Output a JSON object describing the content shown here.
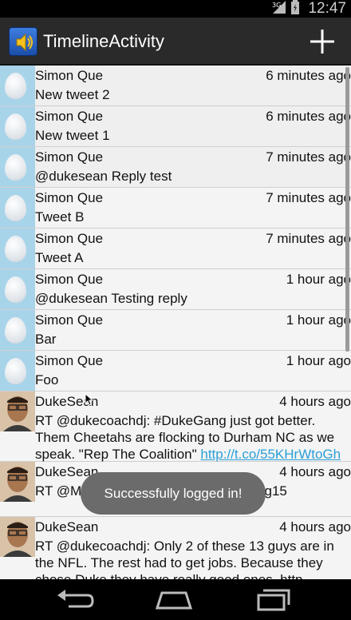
{
  "status_bar": {
    "time": "12:47",
    "network_label": "3G"
  },
  "action_bar": {
    "title": "TimelineActivity",
    "app_icon": "speaker-icon",
    "add_icon": "plus-icon"
  },
  "tweets": [
    {
      "name": "Simon Que",
      "time": "6 minutes ago",
      "text": "New tweet 2",
      "avatar": "egg"
    },
    {
      "name": "Simon Que",
      "time": "6 minutes ago",
      "text": "New tweet 1",
      "avatar": "egg"
    },
    {
      "name": "Simon Que",
      "time": "7 minutes ago",
      "text": "@dukesean Reply test",
      "avatar": "egg"
    },
    {
      "name": "Simon Que",
      "time": "7 minutes ago",
      "text": "Tweet B",
      "avatar": "egg"
    },
    {
      "name": "Simon Que",
      "time": "7 minutes ago",
      "text": "Tweet A",
      "avatar": "egg"
    },
    {
      "name": "Simon Que",
      "time": "1 hour ago",
      "text": "@dukesean Testing reply",
      "avatar": "egg"
    },
    {
      "name": "Simon Que",
      "time": "1 hour ago",
      "text": "Bar",
      "avatar": "egg"
    },
    {
      "name": "Simon Que",
      "time": "1 hour ago",
      "text": "Foo",
      "avatar": "egg"
    },
    {
      "name": "DukeSean",
      "time": "4 hours ago",
      "text": "RT @dukecoachdj: #DukeGang just got better. Them Cheetahs are flocking to Durham NC as we speak. \"Rep The Coalition\" ",
      "link": "http://t.co/55KHrWtoGh",
      "avatar": "photo"
    },
    {
      "name": "DukeSean",
      "time": "4 hours ago",
      "text": "RT @Mattlv... #Coalition15 #DukeGang15",
      "avatar": "photo"
    },
    {
      "name": "DukeSean",
      "time": "4 hours ago",
      "text": "RT @dukecoachdj: Only 2 of these 13 guys are in the NFL. The rest had to get jobs. Because they chose Duke they have really good ones. http",
      "avatar": "photo"
    }
  ],
  "toast": {
    "message": "Successfully logged in!"
  },
  "nav_bar": {
    "back_icon": "back-icon",
    "home_icon": "home-icon",
    "recents_icon": "recents-icon"
  },
  "colors": {
    "action_bar": "#2a2a2a",
    "list_bg": "#f4f4f4",
    "egg_avatar_bg": "#a8d4ea",
    "link": "#2a9fd8",
    "toast": "#6b6b6b"
  }
}
